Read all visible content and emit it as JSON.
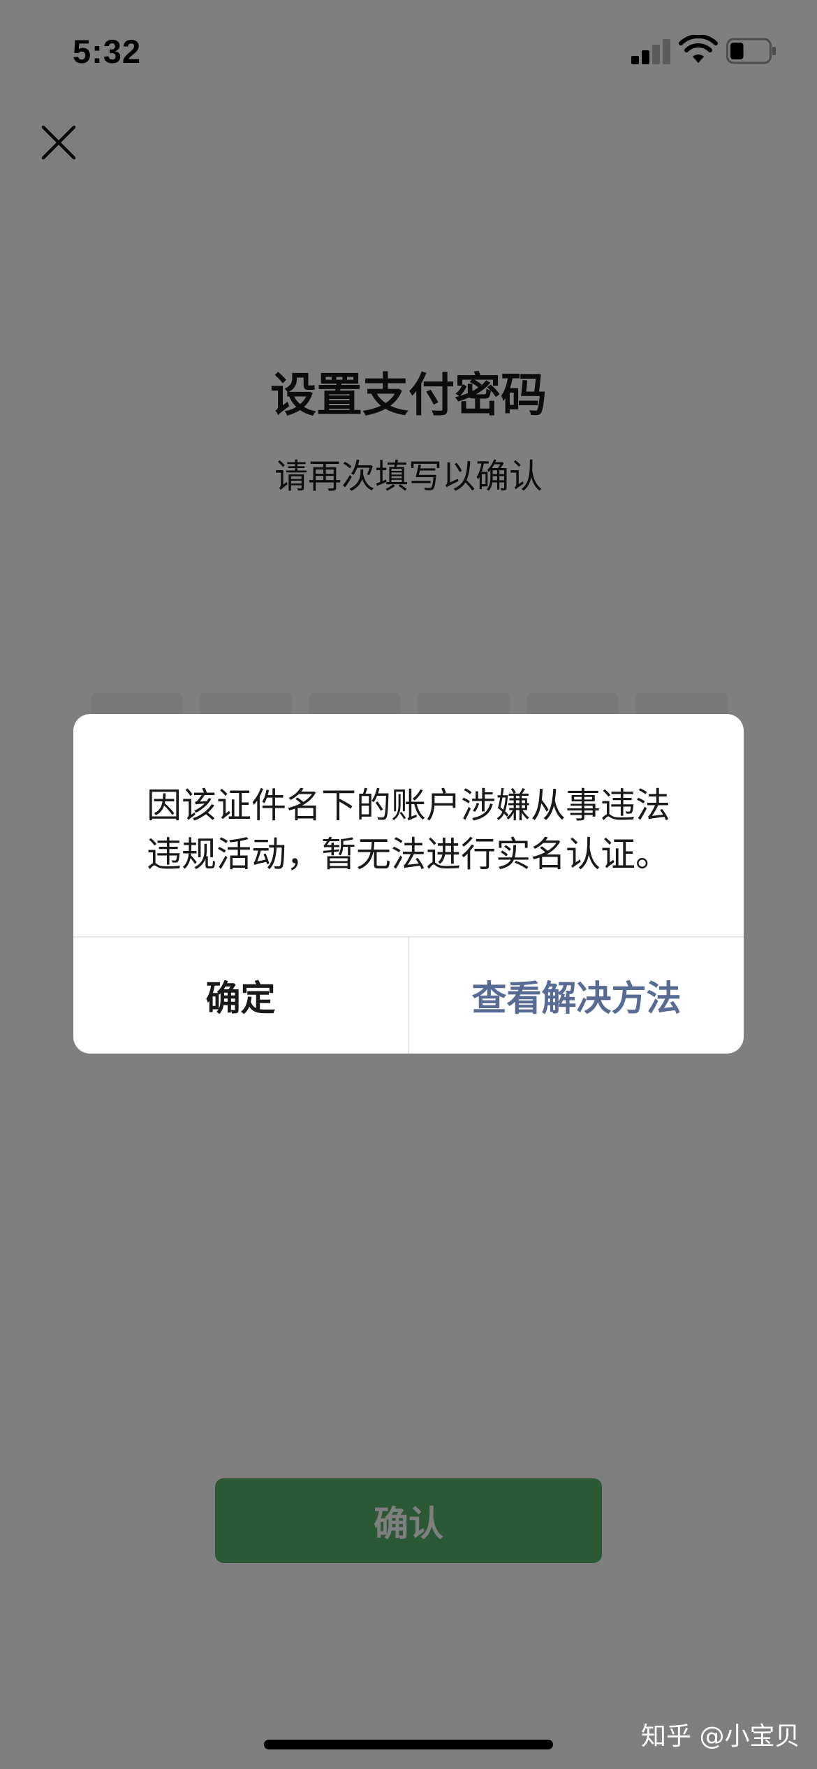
{
  "status_bar": {
    "time": "5:32",
    "signal_icon": "cellular-signal-icon",
    "wifi_icon": "wifi-icon",
    "battery_icon": "battery-icon",
    "battery_level": 0.35
  },
  "header": {
    "close_icon": "close-icon"
  },
  "page": {
    "title": "设置支付密码",
    "subtitle": "请再次填写以确认",
    "pin_length": 6,
    "confirm_label": "确认"
  },
  "dialog": {
    "message_line1": "因该证件名下的账户涉嫌从事违法",
    "message_line2": "违规活动，暂无法进行实名认证。",
    "ok_label": "确定",
    "help_label": "查看解决方法"
  },
  "watermark": "知乎 @小宝贝",
  "colors": {
    "accent_green": "#57b06a",
    "link_blue": "#576b95",
    "text_primary": "#191919",
    "overlay": "rgba(0,0,0,0.5)"
  }
}
